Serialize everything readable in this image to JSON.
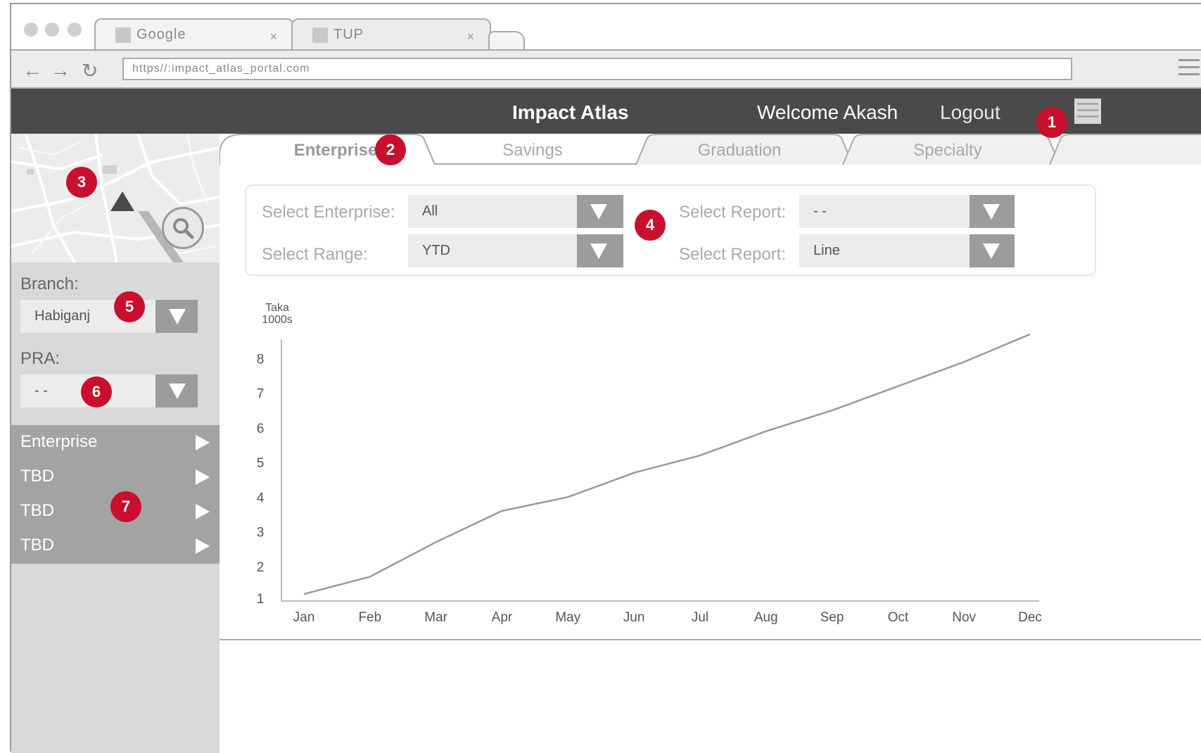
{
  "browser": {
    "tabs": [
      {
        "title": "Google",
        "close": "×"
      },
      {
        "title": "TUP",
        "close": "×"
      }
    ],
    "url": "https//:impact_atlas_portal.com",
    "nav": {
      "back": "←",
      "forward": "→",
      "reload": "↻"
    }
  },
  "header": {
    "title": "Impact Atlas",
    "welcome": "Welcome Akash",
    "logout": "Logout"
  },
  "tabs": [
    {
      "label": "Enterprise",
      "active": true
    },
    {
      "label": "Savings",
      "active": false
    },
    {
      "label": "Graduation",
      "active": false
    },
    {
      "label": "Specialty",
      "active": false
    }
  ],
  "filters": {
    "enterprise_label": "Select Enterprise:",
    "enterprise_value": "All",
    "range_label": "Select Range:",
    "range_value": "YTD",
    "report1_label": "Select Report:",
    "report1_value": "- -",
    "report2_label": "Select Report:",
    "report2_value": "Line"
  },
  "sidebar": {
    "branch_label": "Branch:",
    "branch_value": "Habiganj",
    "pra_label": "PRA:",
    "pra_value": "- -",
    "menu": [
      {
        "label": "Enterprise"
      },
      {
        "label": "TBD"
      },
      {
        "label": "TBD"
      },
      {
        "label": "TBD"
      }
    ]
  },
  "badges": [
    "1",
    "2",
    "3",
    "4",
    "5",
    "6",
    "7"
  ],
  "chart_data": {
    "type": "line",
    "ylabel_line1": "Taka",
    "ylabel_line2": "1000s",
    "categories": [
      "Jan",
      "Feb",
      "Mar",
      "Apr",
      "May",
      "Jun",
      "Jul",
      "Aug",
      "Sep",
      "Oct",
      "Nov",
      "Dec"
    ],
    "series": [
      {
        "values": [
          1.2,
          1.7,
          2.7,
          3.6,
          4.0,
          4.7,
          5.2,
          5.9,
          6.5,
          7.2,
          7.9,
          8.7
        ]
      }
    ],
    "yticks": [
      1,
      2,
      3,
      4,
      5,
      6,
      7,
      8
    ],
    "ylim": [
      1,
      8.8
    ],
    "grid": false,
    "colors": {
      "line": "#9a9a9a",
      "axis": "#bdbdbd",
      "text": "#555555"
    }
  }
}
